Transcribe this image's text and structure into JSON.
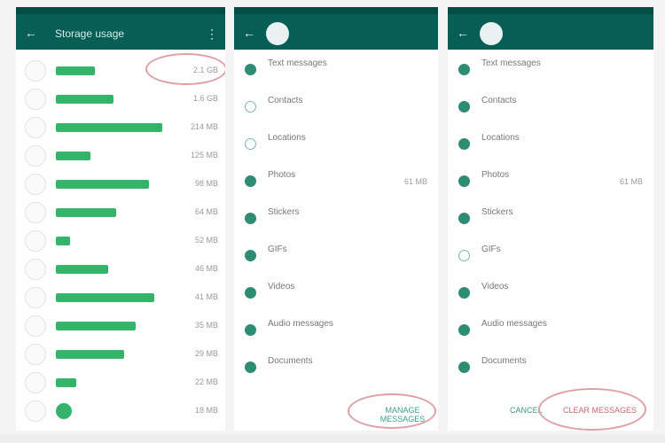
{
  "colors": {
    "header": "#075e54",
    "accent": "#34b46a",
    "annotation": "#dea0a5"
  },
  "panel1": {
    "title": "Storage usage",
    "first_value": "2.1 GB",
    "rows": [
      {
        "label": "",
        "value": "1.6 GB",
        "bar_fraction": 0.53
      },
      {
        "label": "",
        "value": "214 MB",
        "bar_fraction": 0.98
      },
      {
        "label": "",
        "value": "125 MB",
        "bar_fraction": 0.32
      },
      {
        "label": "",
        "value": "98 MB",
        "bar_fraction": 0.86
      },
      {
        "label": "",
        "value": "64 MB",
        "bar_fraction": 0.56
      },
      {
        "label": "",
        "value": "52 MB",
        "bar_fraction": 0.13
      },
      {
        "label": "",
        "value": "46 MB",
        "bar_fraction": 0.48
      },
      {
        "label": "",
        "value": "41 MB",
        "bar_fraction": 0.91
      },
      {
        "label": "",
        "value": "35 MB",
        "bar_fraction": 0.74
      },
      {
        "label": "",
        "value": "29 MB",
        "bar_fraction": 0.63
      },
      {
        "label": "",
        "value": "22 MB",
        "bar_fraction": 0.19
      },
      {
        "label": "",
        "value": "18 MB",
        "bar_fraction": 0.0
      }
    ]
  },
  "panel2": {
    "contact_name": "",
    "contact_sub": "",
    "rows": [
      {
        "title": "Text messages",
        "sub": "",
        "value": ""
      },
      {
        "title": "Contacts",
        "sub": "",
        "value": ""
      },
      {
        "title": "Locations",
        "sub": "",
        "value": ""
      },
      {
        "title": "Photos",
        "sub": "",
        "value": "61 MB"
      },
      {
        "title": "Stickers",
        "sub": "",
        "value": ""
      },
      {
        "title": "GIFs",
        "sub": "",
        "value": ""
      },
      {
        "title": "Videos",
        "sub": "",
        "value": ""
      },
      {
        "title": "Audio messages",
        "sub": "",
        "value": ""
      },
      {
        "title": "Documents",
        "sub": "",
        "value": ""
      }
    ],
    "button_label": "MANAGE MESSAGES"
  },
  "panel3": {
    "contact_name": "",
    "contact_sub": "",
    "rows": [
      {
        "title": "Text messages",
        "sub": "",
        "value": ""
      },
      {
        "title": "Contacts",
        "sub": "",
        "value": ""
      },
      {
        "title": "Locations",
        "sub": "",
        "value": ""
      },
      {
        "title": "Photos",
        "sub": "",
        "value": "61 MB"
      },
      {
        "title": "Stickers",
        "sub": "",
        "value": ""
      },
      {
        "title": "GIFs",
        "sub": "",
        "value": ""
      },
      {
        "title": "Videos",
        "sub": "",
        "value": ""
      },
      {
        "title": "Audio messages",
        "sub": "",
        "value": ""
      },
      {
        "title": "Documents",
        "sub": "",
        "value": ""
      }
    ],
    "cancel_label": "CANCEL",
    "clear_label": "CLEAR MESSAGES"
  }
}
